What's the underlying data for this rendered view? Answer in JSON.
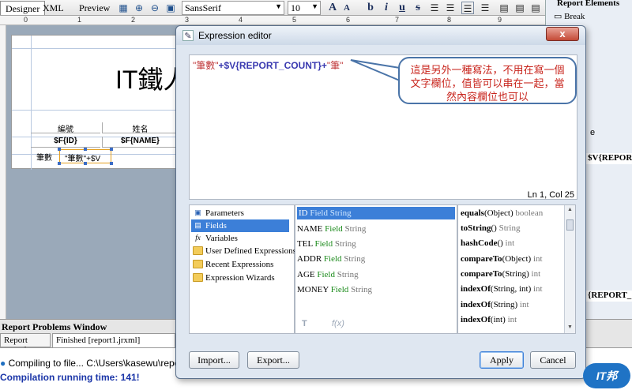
{
  "toolbar": {
    "tabs": [
      "Designer",
      "XML",
      "Preview"
    ],
    "font_name": "SansSerif",
    "font_size": "10",
    "format_buttons": [
      "A",
      "A",
      "b",
      "i",
      "u",
      "s"
    ]
  },
  "ruler": {
    "marks": [
      "0",
      "1",
      "2",
      "3",
      "4",
      "5",
      "6",
      "7",
      "8",
      "9"
    ]
  },
  "report": {
    "title": "IT鐵人",
    "header_cols": [
      "編號",
      "姓名"
    ],
    "detail_cols": [
      "$F{ID}",
      "$F{NAME}"
    ],
    "summary_label": "筆數",
    "summary_expr": "\"筆數\"+$V"
  },
  "right_panel": {
    "title": "Report Elements",
    "item": "Break",
    "extra_e": "e",
    "block1": "$V{REPORT_",
    "block2": "{REPORT_"
  },
  "problems": {
    "title": "Report Problems Window",
    "tabs": [
      "Report console",
      "Finished [report1.jrxml]"
    ],
    "lines": [
      "Compiling to file... C:\\Users\\kasewu\\report",
      "Compilation running time: 141!"
    ]
  },
  "dialog": {
    "title": "Expression editor",
    "close": "x",
    "expression": {
      "part1": "\"筆數\"",
      "part2": "+$V{REPORT_COUNT}+",
      "part3": "\"筆\""
    },
    "position": "Ln 1, Col 25",
    "tree": [
      {
        "label": "Parameters",
        "icon": "P"
      },
      {
        "label": "Fields",
        "icon": "F"
      },
      {
        "label": "Variables",
        "icon": "fx"
      },
      {
        "label": "User Defined Expressions",
        "icon": ""
      },
      {
        "label": "Recent Expressions",
        "icon": ""
      },
      {
        "label": "Expression Wizards",
        "icon": ""
      }
    ],
    "fields": [
      {
        "name": "ID",
        "kind": "Field",
        "type": "String"
      },
      {
        "name": "NAME",
        "kind": "Field",
        "type": "String"
      },
      {
        "name": "TEL",
        "kind": "Field",
        "type": "String"
      },
      {
        "name": "ADDR",
        "kind": "Field",
        "type": "String"
      },
      {
        "name": "AGE",
        "kind": "Field",
        "type": "String"
      },
      {
        "name": "MONEY",
        "kind": "Field",
        "type": "String"
      }
    ],
    "methods": [
      {
        "name": "equals",
        "args": "(Object)",
        "ret": "boolean"
      },
      {
        "name": "toString",
        "args": "()",
        "ret": "String"
      },
      {
        "name": "hashCode",
        "args": "()",
        "ret": "int"
      },
      {
        "name": "compareTo",
        "args": "(Object)",
        "ret": "int"
      },
      {
        "name": "compareTo",
        "args": "(String)",
        "ret": "int"
      },
      {
        "name": "indexOf",
        "args": "(String, int)",
        "ret": "int"
      },
      {
        "name": "indexOf",
        "args": "(String)",
        "ret": "int"
      },
      {
        "name": "indexOf",
        "args": "(int)",
        "ret": "int"
      }
    ],
    "mid_icons": [
      "T",
      "f(x)"
    ],
    "buttons": {
      "import": "Import...",
      "export": "Export...",
      "apply": "Apply",
      "cancel": "Cancel"
    }
  },
  "callout": {
    "text": "這是另外一種寫法，不用在寫一個文字欄位，值皆可以串在一起，當然內容欄位也可以"
  },
  "logo": {
    "text": "IT邦"
  },
  "colors": {
    "selection": "#3c7fd8",
    "callout_text": "#c8251d",
    "callout_border": "#4a74a8"
  }
}
